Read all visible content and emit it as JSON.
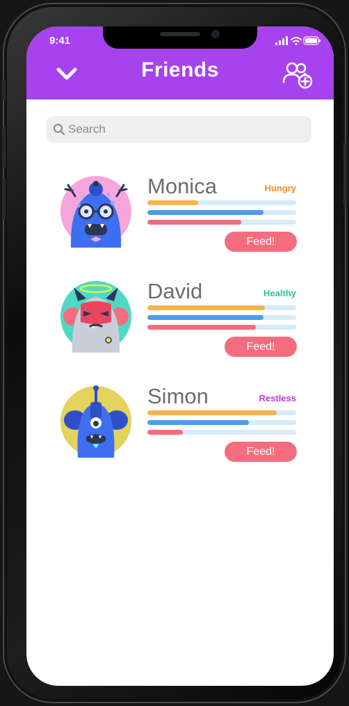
{
  "status_bar": {
    "time": "9:41"
  },
  "header": {
    "title": "Friends"
  },
  "search": {
    "placeholder": "Search"
  },
  "colors": {
    "accent": "#a742ef",
    "hunger_bar": "#f8b24f",
    "energy_bar": "#4c9bf0",
    "health_bar": "#f36d7e",
    "feed_button": "#f36d7e"
  },
  "friends": [
    {
      "name": "Monica",
      "status": "Hungry",
      "status_color": "#f28c2a",
      "bars": [
        0.34,
        0.78,
        0.63
      ],
      "feed_label": "Feed!",
      "avatar": "blue-monster-antlers-avatar"
    },
    {
      "name": "David",
      "status": "Healthy",
      "status_color": "#2cc2a6",
      "bars": [
        0.79,
        0.78,
        0.73
      ],
      "feed_label": "Feed!",
      "avatar": "devil-monster-halo-avatar"
    },
    {
      "name": "Simon",
      "status": "Restless",
      "status_color": "#c03bd9",
      "bars": [
        0.87,
        0.68,
        0.24
      ],
      "feed_label": "Feed!",
      "avatar": "cyclops-monster-antenna-avatar"
    }
  ]
}
